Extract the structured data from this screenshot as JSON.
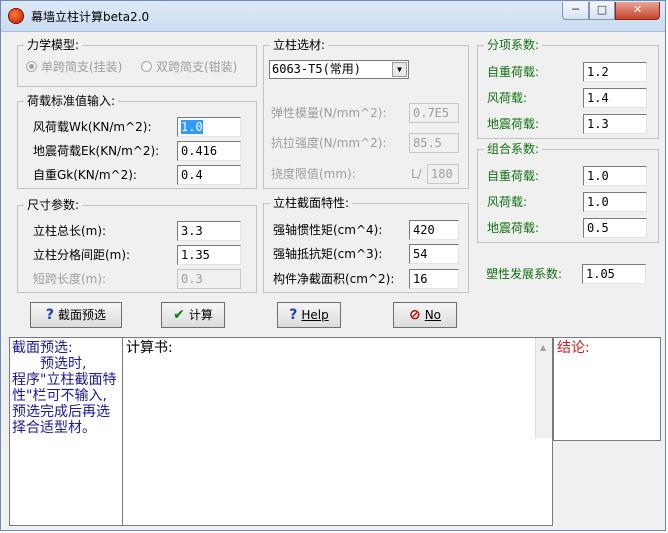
{
  "window": {
    "title": "幕墙立柱计算beta2.0",
    "minimize_label": "─",
    "maximize_label": "□",
    "close_label": "✕"
  },
  "model": {
    "title": "力学模型:",
    "options": [
      "单跨简支(挂装)",
      "双跨简支(钳装)"
    ]
  },
  "load": {
    "title": "荷载标准值输入:",
    "wind_label": "风荷载Wk(KN/m^2):",
    "wind_value": "1.0",
    "seismic_label": "地震荷载Ek(KN/m^2):",
    "seismic_value": "0.416",
    "dead_label": "自重Gk(KN/m^2):",
    "dead_value": "0.4"
  },
  "size": {
    "title": "尺寸参数:",
    "length_label": "立柱总长(m):",
    "length_value": "3.3",
    "spacing_label": "立柱分格间距(m):",
    "spacing_value": "1.35",
    "short_label": "短跨长度(m):",
    "short_value": "0.3"
  },
  "material": {
    "title": "立柱选材:",
    "selected": "6063-T5(常用)",
    "modulus_label": "弹性模量(N/mm^2):",
    "modulus_value": "0.7E5",
    "strength_label": "抗拉强度(N/mm^2):",
    "strength_value": "85.5",
    "deflection_label": "挠度限值(mm):",
    "deflection_prefix": "L/",
    "deflection_value": "180"
  },
  "section": {
    "title": "立柱截面特性:",
    "inertia_label": "强轴惯性矩(cm^4):",
    "inertia_value": "420",
    "modulus_label": "强轴抵抗矩(cm^3):",
    "modulus_value": "54",
    "area_label": "构件净截面积(cm^2):",
    "area_value": "16"
  },
  "partial_factors": {
    "title": "分项系数:",
    "dead_label": "自重荷载:",
    "dead_value": "1.2",
    "wind_label": "风荷载:",
    "wind_value": "1.4",
    "seismic_label": "地震荷载:",
    "seismic_value": "1.3"
  },
  "combo_factors": {
    "title": "组合系数:",
    "dead_label": "自重荷载:",
    "dead_value": "1.0",
    "wind_label": "风荷载:",
    "wind_value": "1.0",
    "seismic_label": "地震荷载:",
    "seismic_value": "0.5"
  },
  "plastic": {
    "label": "塑性发展系数:",
    "value": "1.05"
  },
  "buttons": {
    "preselect": "截面预选",
    "calculate": "计算",
    "help": "Help",
    "no": "No"
  },
  "panes": {
    "hint": "截面预选:\n　　预选时,\n程序\"立柱截面特性\"栏可不输入,预选完成后再选择合适型材。",
    "report_title": "计算书:",
    "conclusion_title": "结论:"
  },
  "colors": {
    "hint_text": "#1a1a9a",
    "conclusion_text": "#d02020",
    "group_title_green": "#107010"
  }
}
